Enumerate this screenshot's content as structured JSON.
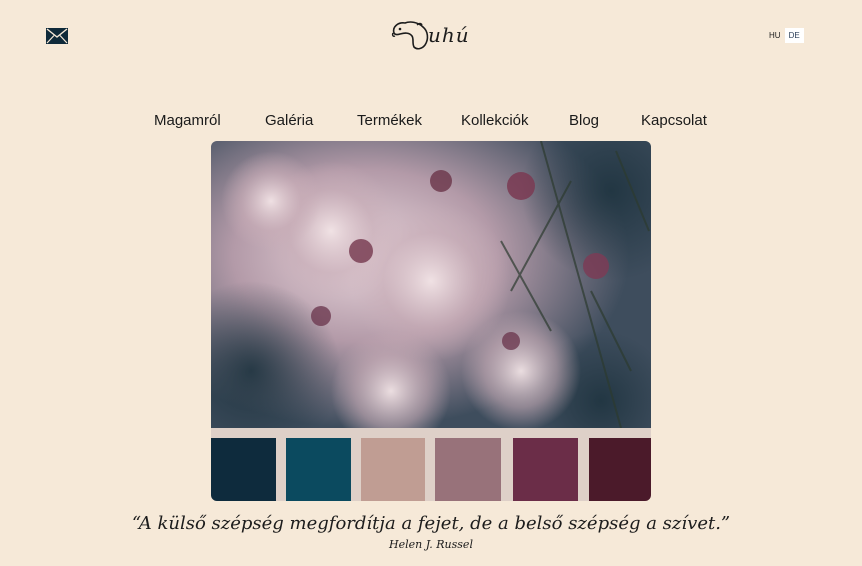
{
  "header": {
    "mail_icon": "envelope-icon",
    "logo_text": "uhú",
    "logo_icon": "bear-head-icon",
    "languages": [
      "HU",
      "DE"
    ],
    "active_language": "DE"
  },
  "nav": {
    "items": [
      "Magamról",
      "Galéria",
      "Termékek",
      "Kollekciók",
      "Blog",
      "Kapcsolat"
    ]
  },
  "hero": {
    "image": "thistle-seed-heads-photo",
    "palette": [
      "#0e2b3d",
      "#0b4a5f",
      "#c09d93",
      "#98727a",
      "#6b2d48",
      "#4b1a2a"
    ]
  },
  "quote": {
    "text": "“A külső szépség megfordítja a fejet, de a belső szépség a szívet.”",
    "author": "Helen J. Russel"
  }
}
